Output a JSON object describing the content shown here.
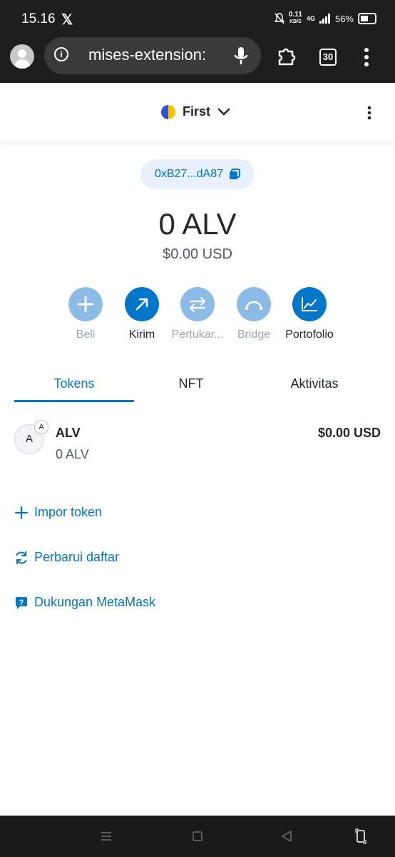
{
  "status_bar": {
    "time": "15.16",
    "x_logo": "𝕏",
    "speed_value": "0.11",
    "speed_unit": "KB/S",
    "network": "4G",
    "battery": "56%"
  },
  "browser": {
    "url": "mises-extension:",
    "tabs_count": "30"
  },
  "header": {
    "network_name": "First"
  },
  "account": {
    "address": "0xB27...dA87",
    "balance": "0 ALV",
    "balance_usd": "$0.00 USD"
  },
  "actions": [
    {
      "label": "Beli",
      "icon": "plus-icon"
    },
    {
      "label": "Kirim",
      "icon": "arrow-up-right-icon"
    },
    {
      "label": "Pertukar...",
      "icon": "swap-icon"
    },
    {
      "label": "Bridge",
      "icon": "bridge-icon"
    },
    {
      "label": "Portofolio",
      "icon": "chart-icon"
    }
  ],
  "tabs": [
    {
      "label": "Tokens",
      "active": true
    },
    {
      "label": "NFT",
      "active": false
    },
    {
      "label": "Aktivitas",
      "active": false
    }
  ],
  "tokens": [
    {
      "avatar": "A",
      "badge": "A",
      "symbol": "ALV",
      "amount": "0 ALV",
      "fiat": "$0.00 USD"
    }
  ],
  "links": {
    "import_token": "Impor token",
    "refresh_list": "Perbarui daftar",
    "support": "Dukungan MetaMask"
  },
  "colors": {
    "primary": "#0376c9",
    "primary_light": "#8bbbe6",
    "address_pill_bg": "#e8f1fb",
    "text_dark": "#24272a",
    "text_muted": "#9fa6ae",
    "system_bar": "#1e1e1e"
  }
}
